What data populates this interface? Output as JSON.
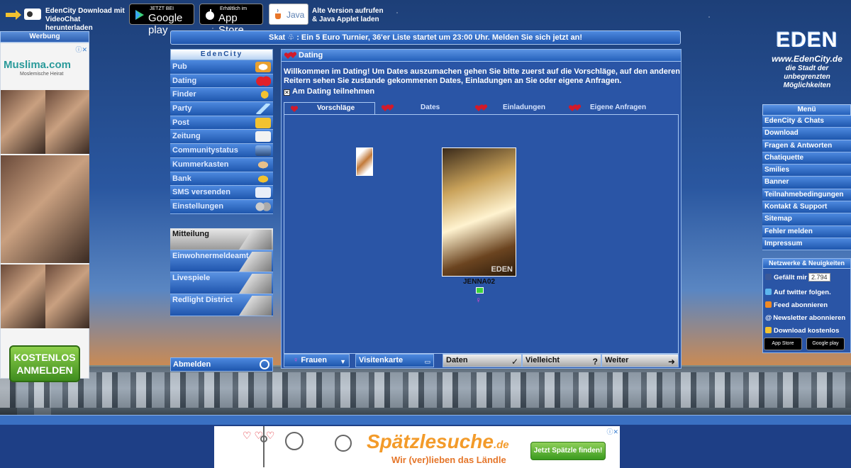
{
  "topbar": {
    "download_text": "EdenCity Download mit VideoChat herunterladen",
    "google_small": "JETZT BEI",
    "google_big": "Google play",
    "apple_small": "Erhältlich im",
    "apple_big": "App Store",
    "java_label": "Java",
    "java_text": "Alte Version aufrufen & Java Applet laden"
  },
  "left_ad": {
    "header": "Werbung",
    "logo": "Muslima.com",
    "subtitle": "Moslemische Heirat",
    "cta": "KOSTENLOS ANMELDEN"
  },
  "skat_banner": "Skat ♧ : Ein 5 Euro Turnier, 36'er Liste startet um 23:00 Uhr. Melden Sie sich jetzt an!",
  "left_nav": {
    "header": "EdenCity",
    "items": [
      {
        "label": "Pub",
        "icon": "beer-icon"
      },
      {
        "label": "Dating",
        "icon": "hearts-icon"
      },
      {
        "label": "Finder",
        "icon": "magnifier-icon"
      },
      {
        "label": "Party",
        "icon": "cocktail-icon"
      },
      {
        "label": "Post",
        "icon": "post-horn-icon"
      },
      {
        "label": "Zeitung",
        "icon": "newspaper-icon"
      },
      {
        "label": "Communitystatus",
        "icon": "city-icon"
      },
      {
        "label": "Kummerkasten",
        "icon": "mailbox-icon"
      },
      {
        "label": "Bank",
        "icon": "money-bag-icon"
      },
      {
        "label": "SMS versenden",
        "icon": "sms-icon"
      },
      {
        "label": "Einstellungen",
        "icon": "gears-icon"
      }
    ],
    "section2": [
      {
        "label": "Mitteilung",
        "icon": "megaphone-icon"
      },
      {
        "label": "Einwohnermeldeamt",
        "icon": "building-icon"
      },
      {
        "label": "Livespiele",
        "icon": "game-board-icon"
      },
      {
        "label": "Redlight District",
        "icon": "woman-icon"
      }
    ],
    "logout": "Abmelden"
  },
  "main": {
    "title": "Dating",
    "welcome": "Willkommen im Dating! Um Dates auszumachen gehen Sie bitte zuerst auf die Vorschläge, auf den anderen Reitern sehen Sie zustande gekommenen Dates, Einladungen an Sie oder eigene Anfragen.",
    "checkbox_label": "Am Dating teilnehmen",
    "tabs": [
      "Vorschläge",
      "Dates",
      "Einladungen",
      "Eigene Anfragen"
    ],
    "profile": {
      "username": "JENNA02",
      "watermark": "EDEN"
    },
    "tools": {
      "filter": "Frauen",
      "card": "Visitenkarte",
      "yes": "Daten",
      "maybe": "Vielleicht",
      "next": "Weiter"
    }
  },
  "right": {
    "logo": "EDEN",
    "url": "www.EdenCity.de",
    "slogan": "die Stadt der unbegrenzten Möglichkeiten",
    "menu_header": "Menü",
    "menu": [
      "EdenCity & Chats",
      "Download",
      "Fragen & Antworten",
      "Chatiquette",
      "Smilies",
      "Banner",
      "Teilnahmebedingungen",
      "Kontakt & Support",
      "Sitemap",
      "Fehler melden",
      "Impressum"
    ],
    "social_header": "Netzwerke & Neuigkeiten",
    "like_label": "Gefällt mir",
    "like_count": "2.794",
    "twitter": "Auf twitter folgen.",
    "feed": "Feed abonnieren",
    "newsletter": "Newsletter abonnieren",
    "download": "Download kostenlos",
    "mini_apple": "App Store",
    "mini_google": "Google play"
  },
  "bottom_ad": {
    "title": "Spätzlesuche",
    "tld": ".de",
    "subtitle": "Wir (ver)lieben das Ländle",
    "cta": "Jetzt Spätzle finden!"
  },
  "colors": {
    "panel": "#2a55a6",
    "button": "#1e56ad",
    "accent_heart": "#d21a2a",
    "female": "#e64ad2"
  }
}
